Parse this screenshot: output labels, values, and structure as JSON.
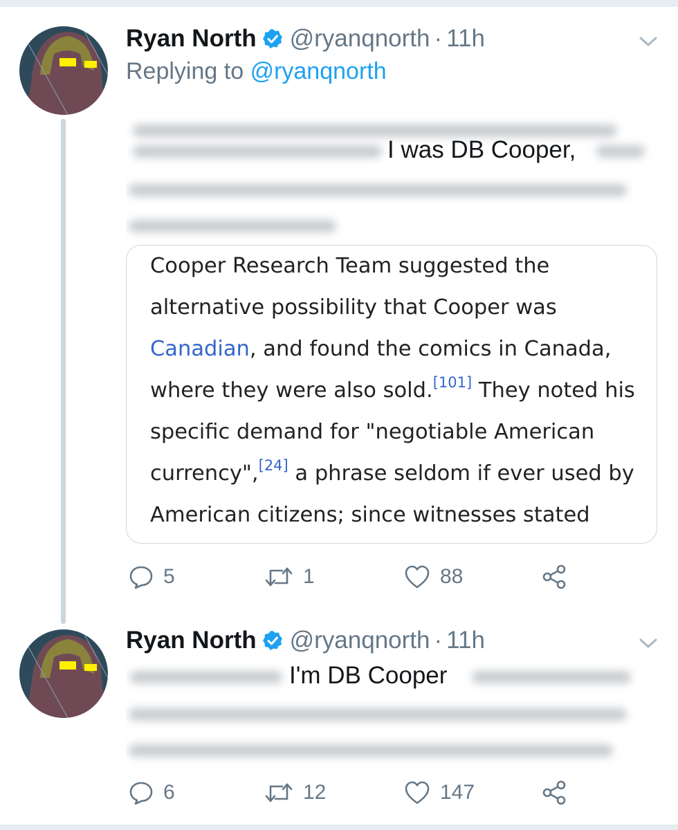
{
  "tweets": [
    {
      "author_name": "Ryan North",
      "handle": "@ryanqnorth",
      "separator": "·",
      "time": "11h",
      "replying_label": "Replying to",
      "replying_to": "@ryanqnorth",
      "text_visible_fragment": "I was DB Cooper,",
      "quote": {
        "line1": "Cooper Research Team suggested the",
        "line2": "alternative possibility that Cooper was",
        "line3_link": "Canadian",
        "line3_rest": ", and found the comics in Canada,",
        "line4_start": "where they were also sold.",
        "line4_ref": "[101]",
        "line4_end": " They noted his",
        "line5": "specific demand for \"negotiable American",
        "line6_start": "currency\",",
        "line6_ref": "[24]",
        "line6_end": " a phrase seldom if ever used by",
        "line7": "American citizens; since witnesses stated"
      },
      "replies": "5",
      "retweets": "1",
      "likes": "88"
    },
    {
      "author_name": "Ryan North",
      "handle": "@ryanqnorth",
      "separator": "·",
      "time": "11h",
      "text_visible_fragment": "I'm DB Cooper",
      "replies": "6",
      "retweets": "12",
      "likes": "147"
    }
  ],
  "colors": {
    "verified": "#1da1f2",
    "link": "#1da1f2",
    "secondary_text": "#657786",
    "wiki_link": "#3366cc"
  },
  "icons": [
    "verified-badge-icon",
    "chevron-down-icon",
    "reply-icon",
    "retweet-icon",
    "like-icon",
    "share-icon"
  ]
}
